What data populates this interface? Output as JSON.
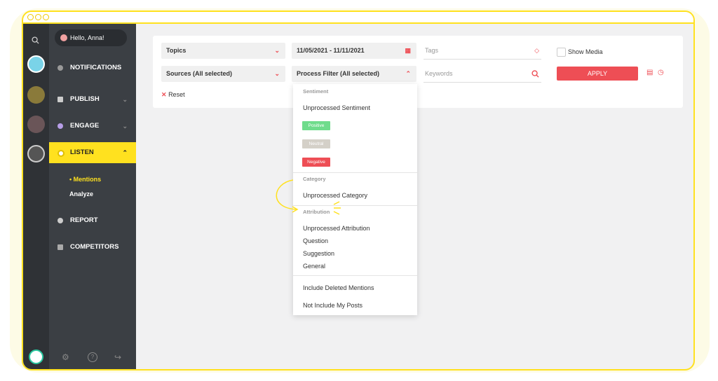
{
  "user": {
    "greeting": "Hello, Anna!"
  },
  "nav": {
    "notifications": "NOTIFICATIONS",
    "publish": "PUBLISH",
    "engage": "ENGAGE",
    "listen": "LISTEN",
    "mentions": "Mentions",
    "analyze": "Analyze",
    "report": "REPORT",
    "competitors": "COMPETITORS"
  },
  "filters": {
    "topics": "Topics",
    "date_range": "11/05/2021 - 11/11/2021",
    "tags_placeholder": "Tags",
    "show_media": "Show Media",
    "sources": "Sources (All selected)",
    "process_filter": "Process Filter (All selected)",
    "keywords_placeholder": "Keywords",
    "apply": "APPLY",
    "reset": "Reset"
  },
  "dropdown": {
    "sentiment_header": "Sentiment",
    "unprocessed_sentiment": "Unprocessed Sentiment",
    "positive": "Positive",
    "neutral": "Neutral",
    "negative": "Negative",
    "category_header": "Category",
    "unprocessed_category": "Unprocessed Category",
    "attribution_header": "Attribution",
    "unprocessed_attribution": "Unprocessed Attribution",
    "question": "Question",
    "suggestion": "Suggestion",
    "general": "General",
    "include_deleted": "Include Deleted Mentions",
    "not_include_posts": "Not Include My Posts"
  },
  "colors": {
    "accent": "#ffe11f",
    "apply": "#ee4e55",
    "positive": "#6fdc8c",
    "neutral": "#cccccc",
    "negative": "#ee4e55",
    "sidebar": "#3b3f44"
  },
  "icons": [
    "search-icon",
    "calendar-icon",
    "tag-icon",
    "pdf-icon",
    "settings-icon",
    "help-icon",
    "logout-icon"
  ]
}
